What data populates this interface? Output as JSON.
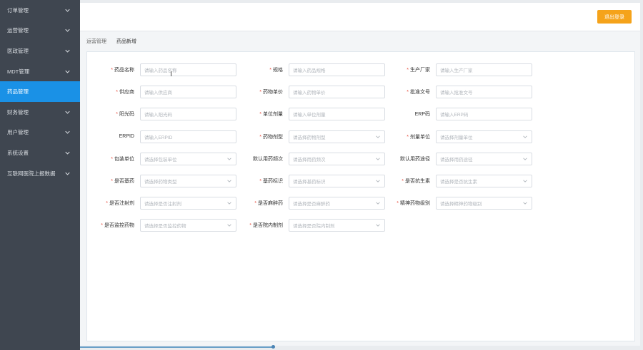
{
  "sidebar": {
    "items": [
      {
        "label": "订单管理",
        "expandable": true,
        "active": false
      },
      {
        "label": "运营管理",
        "expandable": true,
        "active": false
      },
      {
        "label": "医政管理",
        "expandable": true,
        "active": false
      },
      {
        "label": "MDT管理",
        "expandable": true,
        "active": false
      },
      {
        "label": "药品管理",
        "expandable": false,
        "active": true
      },
      {
        "label": "财务管理",
        "expandable": true,
        "active": false
      },
      {
        "label": "用户管理",
        "expandable": true,
        "active": false
      },
      {
        "label": "系统设置",
        "expandable": true,
        "active": false
      },
      {
        "label": "互联网医院上报数据",
        "expandable": true,
        "active": false
      }
    ]
  },
  "header": {
    "logout_label": "退出登录"
  },
  "breadcrumb": {
    "parent": "运营管理",
    "current": "药品新增"
  },
  "form": {
    "rows": [
      [
        {
          "label": "药品名称",
          "required": true,
          "placeholder": "请输入药品名称",
          "type": "input"
        },
        {
          "label": "规格",
          "required": true,
          "placeholder": "请输入药品规格",
          "type": "input"
        },
        {
          "label": "生产厂家",
          "required": true,
          "placeholder": "请输入生产厂家",
          "type": "input"
        }
      ],
      [
        {
          "label": "供应商",
          "required": true,
          "placeholder": "请输入供应商",
          "type": "input"
        },
        {
          "label": "药物单价",
          "required": true,
          "placeholder": "请输入药物单价",
          "type": "input"
        },
        {
          "label": "批准文号",
          "required": true,
          "placeholder": "请输入批准文号",
          "type": "input"
        }
      ],
      [
        {
          "label": "阳光码",
          "required": true,
          "placeholder": "请输入阳光码",
          "type": "input"
        },
        {
          "label": "单位剂量",
          "required": true,
          "placeholder": "请输入单位剂量",
          "type": "input"
        },
        {
          "label": "ERP码",
          "required": false,
          "placeholder": "请输入ERP码",
          "type": "input"
        }
      ],
      [
        {
          "label": "ERPID",
          "required": false,
          "placeholder": "请输入ERPID",
          "type": "input"
        },
        {
          "label": "药物剂型",
          "required": true,
          "placeholder": "请选择药物剂型",
          "type": "select"
        },
        {
          "label": "剂量单位",
          "required": true,
          "placeholder": "请选择剂量单位",
          "type": "select"
        }
      ],
      [
        {
          "label": "包装单位",
          "required": true,
          "placeholder": "请选择包装单位",
          "type": "select"
        },
        {
          "label": "默认用药频次",
          "required": false,
          "placeholder": "请选择用药频次",
          "type": "select"
        },
        {
          "label": "默认用药途径",
          "required": false,
          "placeholder": "请选择用药途径",
          "type": "select"
        }
      ],
      [
        {
          "label": "是否基药",
          "required": true,
          "placeholder": "请选择药物类型",
          "type": "select"
        },
        {
          "label": "基药标识",
          "required": true,
          "placeholder": "请选择基药标识",
          "type": "select"
        },
        {
          "label": "是否抗生素",
          "required": true,
          "placeholder": "请选择是否抗生素",
          "type": "select"
        }
      ],
      [
        {
          "label": "是否注射剂",
          "required": true,
          "placeholder": "请选择是否注射剂",
          "type": "select"
        },
        {
          "label": "是否麻醉药",
          "required": true,
          "placeholder": "请选择是否麻醉药",
          "type": "select"
        },
        {
          "label": "精神药物级别",
          "required": true,
          "placeholder": "请选择精神药物级别",
          "type": "select"
        }
      ],
      [
        {
          "label": "是否监控药物",
          "required": true,
          "placeholder": "请选择是否监控药物",
          "type": "select"
        },
        {
          "label": "是否院内制剂",
          "required": true,
          "placeholder": "请选择是否院内制剂",
          "type": "select"
        }
      ]
    ]
  },
  "colors": {
    "sidebar_bg": "#3f4650",
    "active_item": "#1a91e6",
    "logout_button": "#f5a31a",
    "required_mark": "#e74c3c"
  },
  "icons": {
    "expand": "chevron-down-icon",
    "select_caret": "chevron-down-icon",
    "cursor": "text-cursor-icon"
  }
}
